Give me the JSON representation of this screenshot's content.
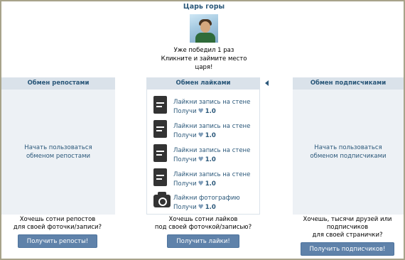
{
  "king": {
    "title": "Царь горы",
    "line1": "Уже победил 1 раз",
    "line2": "Кликните и займите место",
    "line3": "царя!"
  },
  "left": {
    "header": "Обмен репостами",
    "empty_line1": "Начать пользоваться",
    "empty_line2": "обменом репостами",
    "promo_line1": "Хочешь сотни репостов",
    "promo_line2": "для своей фоточки/записи?",
    "button": "Получить репосты!"
  },
  "center": {
    "header": "Обмен лайками",
    "tasks": [
      {
        "icon": "document-icon",
        "title": "Лайкни запись на стене",
        "reward_prefix": "Получи",
        "reward": "1.0"
      },
      {
        "icon": "document-icon",
        "title": "Лайкни запись на стене",
        "reward_prefix": "Получи",
        "reward": "1.0"
      },
      {
        "icon": "document-icon",
        "title": "Лайкни запись на стене",
        "reward_prefix": "Получи",
        "reward": "1.0"
      },
      {
        "icon": "document-icon",
        "title": "Лайкни запись на стене",
        "reward_prefix": "Получи",
        "reward": "1.0"
      },
      {
        "icon": "camera-icon",
        "title": "Лайкни фотографию",
        "reward_prefix": "Получи",
        "reward": "1.0"
      }
    ],
    "promo_line1": "Хочешь сотни лайков",
    "promo_line2": "под своей фоточкой/записью?",
    "button": "Получить лайки!"
  },
  "right": {
    "header": "Обмен подписчиками",
    "empty_line1": "Начать пользоваться",
    "empty_line2": "обменом подписчиками",
    "promo_line1": "Хочешь, тысячи друзей или",
    "promo_line2": "подписчиков",
    "promo_line3": "для своей странички?",
    "button": "Получить подписчиков!"
  },
  "colors": {
    "accent": "#2b587a",
    "header_bg": "#dae2ea",
    "panel_bg": "#edf1f5",
    "button_bg": "#5f82aa"
  }
}
